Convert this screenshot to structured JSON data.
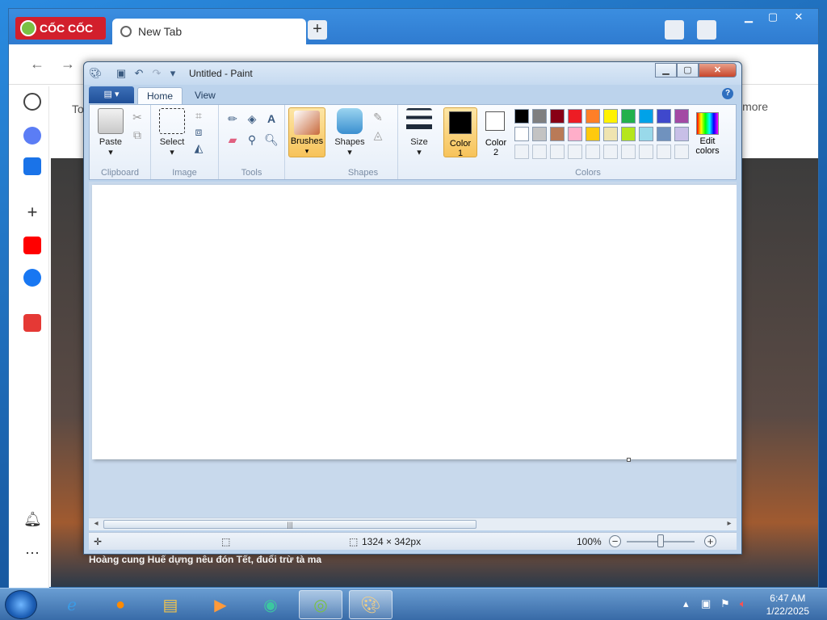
{
  "browser": {
    "brand": "CỐC CỐC",
    "tab_title": "New Tab",
    "new_tab_glyph": "+",
    "notice_text": "To g",
    "more_text": "more",
    "news_headline": "Hoàng cung Huế dựng nêu đón Tết, đuổi trừ tà ma"
  },
  "paint": {
    "title": "Untitled - Paint",
    "tabs": {
      "file": "▤ ▾",
      "home": "Home",
      "view": "View"
    },
    "help": "?",
    "groups": {
      "clipboard": "Clipboard",
      "image": "Image",
      "tools": "Tools",
      "shapes": "Shapes",
      "colors": "Colors"
    },
    "buttons": {
      "paste": "Paste",
      "select": "Select",
      "brushes": "Brushes",
      "shapes": "Shapes",
      "size": "Size",
      "color1_line1": "Color",
      "color1_line2": "1",
      "color2_line1": "Color",
      "color2_line2": "2",
      "edit_line1": "Edit",
      "edit_line2": "colors"
    },
    "color1": "#000000",
    "color2": "#ffffff",
    "palette_row1": [
      "#000000",
      "#7f7f7f",
      "#880015",
      "#ed1c24",
      "#ff7f27",
      "#fff200",
      "#22b14c",
      "#00a2e8",
      "#3f48cc",
      "#a349a4"
    ],
    "palette_row2": [
      "#ffffff",
      "#c3c3c3",
      "#b97a57",
      "#ffaec9",
      "#ffc90e",
      "#efe4b0",
      "#b5e61d",
      "#99d9ea",
      "#7092be",
      "#c8bfe7"
    ],
    "status": {
      "dimensions": "1324 × 342px",
      "zoom": "100%"
    }
  },
  "taskbar": {
    "time": "6:47 AM",
    "date": "1/22/2025"
  }
}
